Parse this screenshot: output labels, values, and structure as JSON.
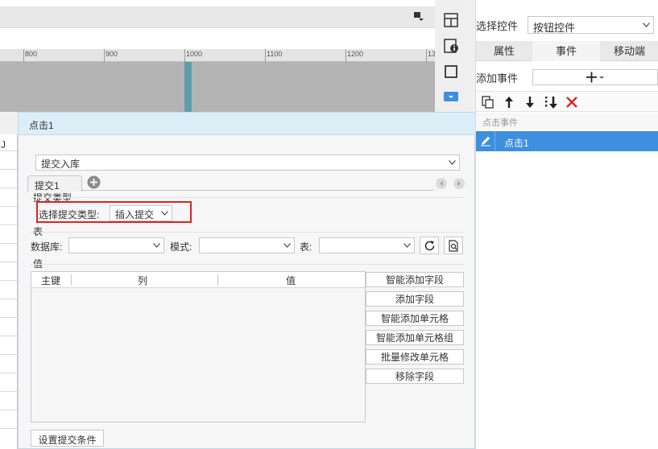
{
  "ruler": {
    "ticks": [
      "800",
      "900",
      "1000",
      "1100",
      "1200",
      "13"
    ]
  },
  "right_panel": {
    "select_control_label": "选择控件",
    "select_control_value": "按钮控件",
    "tabs": [
      "属性",
      "事件",
      "移动端"
    ],
    "active_tab": "事件",
    "add_event_label": "添加事件",
    "list_header": "点击事件",
    "event_item": "点击1"
  },
  "dialog": {
    "title": "点击1",
    "submit_type_value": "提交入库",
    "tab_label": "提交1",
    "section_submit_type": "提交类型",
    "choose_submit_type_label": "选择提交类型:",
    "choose_submit_type_value": "插入提交",
    "section_table": "表",
    "database_label": "数据库:",
    "database_value": "",
    "mode_label": "模式:",
    "mode_value": "",
    "table_label": "表:",
    "table_value": "",
    "section_value": "值",
    "columns": [
      "主键",
      "列",
      "值"
    ],
    "buttons": [
      "智能添加字段",
      "添加字段",
      "智能添加单元格",
      "智能添加单元格组",
      "批量修改单元格",
      "移除字段"
    ],
    "set_condition_button": "设置提交条件"
  },
  "left_column_letter": "J",
  "colors": {
    "accent": "#3e8fde",
    "dialog_title_bg": "#dbeef8",
    "highlight_box": "#e02222",
    "delete_x": "#e02222",
    "teal_column": "#5b9eab"
  }
}
